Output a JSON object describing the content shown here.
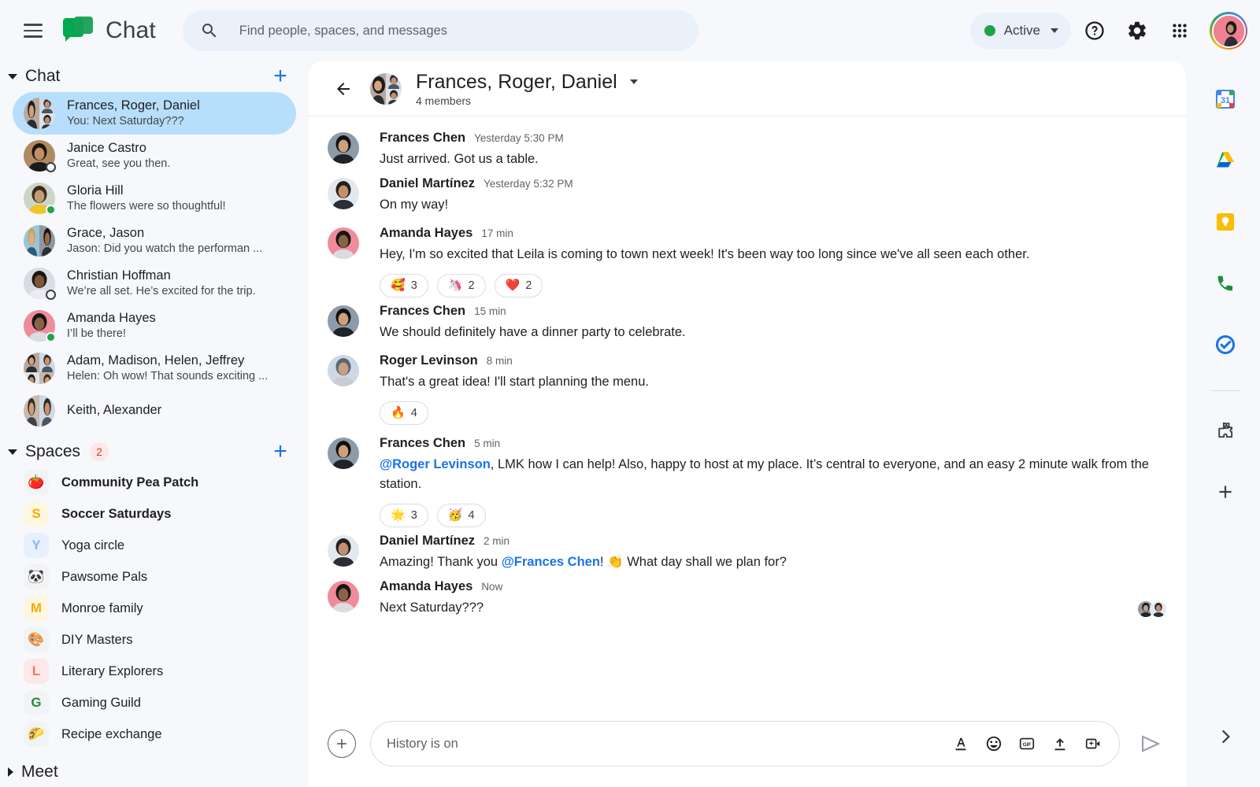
{
  "app": {
    "brand_title": "Chat",
    "hamburger_icon": "hamburger-menu-icon",
    "logo_icon": "google-chat-logo"
  },
  "search": {
    "placeholder": "Find people, spaces, and messages",
    "value": "",
    "icon": "search-icon"
  },
  "topbar": {
    "status_label": "Active",
    "status_color": "#1ea446",
    "help_icon": "help-circle-icon",
    "settings_icon": "gear-icon",
    "apps_icon": "apps-grid-icon",
    "account_icon": "account-avatar"
  },
  "sidebar": {
    "chat_section": {
      "title": "Chat",
      "add_label": "+",
      "expanded": true
    },
    "dms": [
      {
        "name": "Frances, Roger, Daniel",
        "preview": "You: Next Saturday???",
        "active": true,
        "group": true,
        "presence": "none"
      },
      {
        "name": "Janice Castro",
        "preview": "Great, see you then.",
        "active": false,
        "group": false,
        "presence": "off"
      },
      {
        "name": "Gloria Hill",
        "preview": "The flowers were so thoughtful!",
        "active": false,
        "group": false,
        "presence": "on"
      },
      {
        "name": "Grace, Jason",
        "preview": "Jason: Did you watch the performan ...",
        "active": false,
        "group": true,
        "presence": "none"
      },
      {
        "name": "Christian Hoffman",
        "preview": "We’re all set.  He’s excited for the trip.",
        "active": false,
        "group": false,
        "presence": "off"
      },
      {
        "name": "Amanda Hayes",
        "preview": "I’ll be there!",
        "active": false,
        "group": false,
        "presence": "on"
      },
      {
        "name": "Adam, Madison, Helen, Jeffrey",
        "preview": "Helen: Oh wow! That sounds exciting ...",
        "active": false,
        "group": true,
        "presence": "none"
      },
      {
        "name": "Keith, Alexander",
        "preview": "",
        "active": false,
        "group": true,
        "presence": "none"
      }
    ],
    "spaces_section": {
      "title": "Spaces",
      "badge": "2",
      "add_label": "+",
      "expanded": true
    },
    "spaces": [
      {
        "label": "Community Pea Patch",
        "icon": "🍅",
        "emoji": true,
        "unread": true,
        "bg": "#f1f3f4",
        "color": "#d93025"
      },
      {
        "label": "Soccer Saturdays",
        "icon": "S",
        "emoji": false,
        "unread": true,
        "bg": "#fef7e0",
        "color": "#f9ab00"
      },
      {
        "label": "Yoga circle",
        "icon": "Y",
        "emoji": false,
        "unread": false,
        "bg": "#e8f0fe",
        "color": "#8ab4f8"
      },
      {
        "label": "Pawsome Pals",
        "icon": "🐼",
        "emoji": true,
        "unread": false,
        "bg": "#f1f3f4",
        "color": "#3c4043"
      },
      {
        "label": "Monroe family",
        "icon": "M",
        "emoji": false,
        "unread": false,
        "bg": "#fef7e0",
        "color": "#f9ab00"
      },
      {
        "label": "DIY Masters",
        "icon": "🎨",
        "emoji": true,
        "unread": false,
        "bg": "#f1f3f4",
        "color": "#1a73e8"
      },
      {
        "label": "Literary Explorers",
        "icon": "L",
        "emoji": false,
        "unread": false,
        "bg": "#fce8e6",
        "color": "#e8796e"
      },
      {
        "label": "Gaming Guild",
        "icon": "G",
        "emoji": false,
        "unread": false,
        "bg": "#f1f3f4",
        "color": "#1e8e3e"
      },
      {
        "label": "Recipe exchange",
        "icon": "🌮",
        "emoji": true,
        "unread": false,
        "bg": "#f1f3f4",
        "color": "#f9ab00"
      }
    ],
    "meet_section": {
      "title": "Meet",
      "expanded": false
    }
  },
  "conversation": {
    "back_icon": "back-arrow-icon",
    "title": "Frances, Roger, Daniel",
    "members_label": "4 members",
    "dropdown_icon": "chevron-down-icon",
    "messages": [
      {
        "author": "Frances Chen",
        "time": "Yesterday 5:30 PM",
        "text": "Just arrived.  Got us a table.",
        "avatar": "frances-avatar",
        "reactions": []
      },
      {
        "author": "Daniel Martínez",
        "time": "Yesterday 5:32 PM",
        "text": "On my way!",
        "avatar": "daniel-avatar",
        "reactions": []
      },
      {
        "author": "Amanda Hayes",
        "time": "17 min",
        "text": "Hey, I'm so excited that Leila is coming to town next week! It's been way too long since we've all seen each other.",
        "avatar": "amanda-avatar",
        "reactions": [
          {
            "emoji": "🥰",
            "count": "3"
          },
          {
            "emoji": "🦄",
            "count": "2"
          },
          {
            "emoji": "❤️",
            "count": "2"
          }
        ]
      },
      {
        "author": "Frances Chen",
        "time": "15 min",
        "text": "We should definitely have a dinner party to celebrate.",
        "avatar": "frances-avatar",
        "reactions": []
      },
      {
        "author": "Roger Levinson",
        "time": "8 min",
        "text": "That's a great idea! I'll start planning the menu.",
        "avatar": "roger-avatar",
        "reactions": [
          {
            "emoji": "🔥",
            "count": "4"
          }
        ]
      },
      {
        "author": "Frances Chen",
        "time": "5 min",
        "mention_before": "@Roger Levinson",
        "text": ", LMK how I can help!  Also, happy to host at my place. It’s central to everyone, and an easy 2 minute walk from the station.",
        "avatar": "frances-avatar",
        "reactions": [
          {
            "emoji": "🌟",
            "count": "3"
          },
          {
            "emoji": "🥳",
            "count": "4"
          }
        ]
      },
      {
        "author": "Daniel Martínez",
        "time": "2 min",
        "text_before": "Amazing! Thank you ",
        "mention_inline": "@Frances Chen",
        "text_after": "! 👏 What day shall we plan for?",
        "avatar": "daniel-avatar",
        "reactions": []
      },
      {
        "author": "Amanda Hayes",
        "time": "Now",
        "text": "Next Saturday???",
        "avatar": "amanda-avatar",
        "reactions": [],
        "read_receipts": 2
      }
    ]
  },
  "composer": {
    "placeholder": "History is on",
    "value": "",
    "add_icon": "plus-circle-icon",
    "format_icon": "text-format-icon",
    "emoji_icon": "emoji-icon",
    "gif_icon": "gif-icon",
    "upload_icon": "upload-icon",
    "video_icon": "add-video-icon",
    "send_icon": "send-icon"
  },
  "rail": {
    "items": [
      {
        "name": "calendar-icon",
        "label": "31"
      },
      {
        "name": "drive-icon",
        "label": ""
      },
      {
        "name": "keep-icon",
        "label": ""
      },
      {
        "name": "voice-icon",
        "label": ""
      },
      {
        "name": "tasks-icon",
        "label": ""
      }
    ],
    "addon_icon": "puzzle-addon-icon",
    "add_icon": "plus-icon",
    "expand_icon": "chevron-right-icon"
  }
}
